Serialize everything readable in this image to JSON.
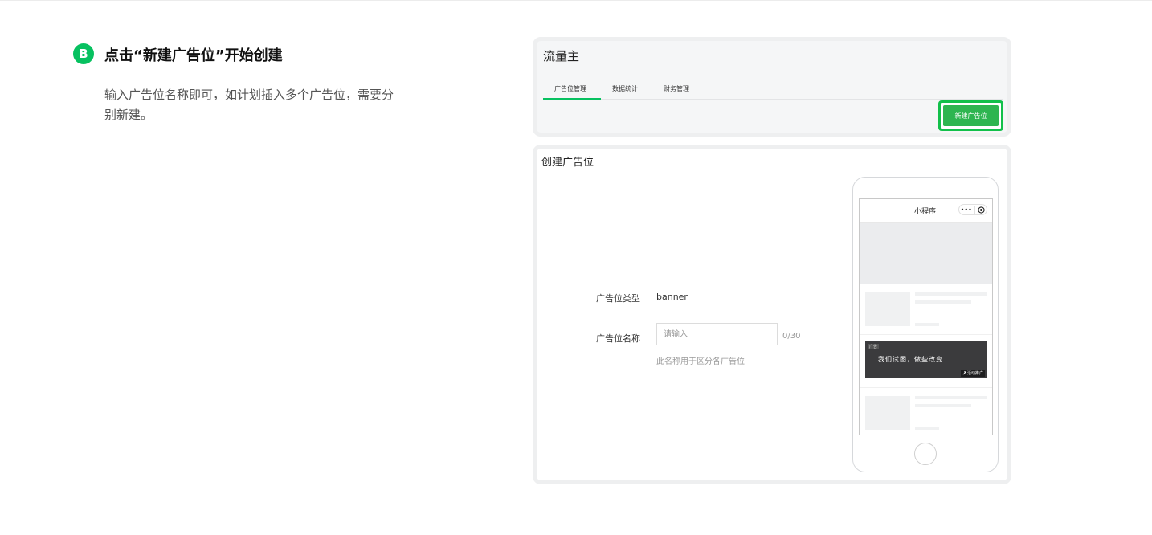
{
  "step": {
    "badge": "B",
    "title": "点击“新建广告位”开始创建",
    "description": "输入广告位名称即可，如计划插入多个广告位，需要分别新建。"
  },
  "header_panel": {
    "title": "流量主",
    "tabs": [
      {
        "label": "广告位管理",
        "active": true
      },
      {
        "label": "数据统计",
        "active": false
      },
      {
        "label": "财务管理",
        "active": false
      }
    ],
    "new_button_label": "新建广告位"
  },
  "create_panel": {
    "title": "创建广告位",
    "type_label": "广告位类型",
    "type_value": "banner",
    "name_label": "广告位名称",
    "name_placeholder": "请输入",
    "name_value": "",
    "counter": "0/30",
    "hint": "此名称用于区分各广告位"
  },
  "phone_preview": {
    "app_title": "小程序",
    "menu_icon": "more-dots-icon",
    "close_icon": "target-circle-icon",
    "ad": {
      "tag": "广告",
      "slogan": "我们试图，做些改变",
      "cta": "活动推广"
    }
  },
  "colors": {
    "accent": "#07c160",
    "button": "#2eb550",
    "highlight_border": "#12c04a",
    "panel_bg": "#f5f6f7",
    "ad_bg": "#3b3b3d"
  }
}
